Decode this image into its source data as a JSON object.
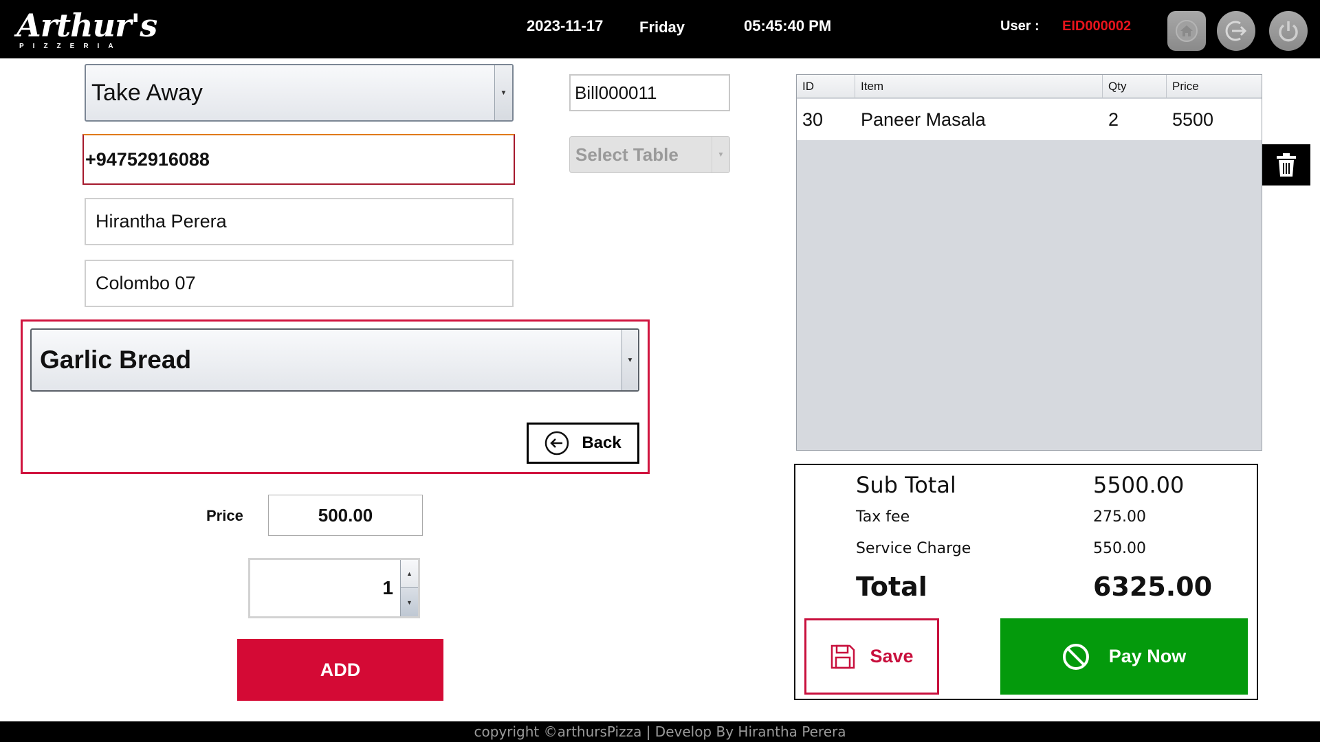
{
  "header": {
    "logo_main": "Arthur's",
    "logo_sub": "PIZZERIA",
    "date": "2023-11-17",
    "day": "Friday",
    "time": "05:45:40 PM",
    "user_label": "User :",
    "user_id": "EID000002",
    "icons": [
      "home-icon",
      "logout-icon",
      "power-icon"
    ]
  },
  "order_form": {
    "order_type": "Take Away",
    "phone": "+94752916088",
    "customer_name": "Hirantha Perera",
    "address": "Colombo 07",
    "bill_no": "Bill000011",
    "table_select": "Select Table"
  },
  "item_panel": {
    "selected_item": "Garlic Bread",
    "back_label": "Back"
  },
  "item_entry": {
    "price_label": "Price",
    "price": "500.00",
    "quantity": "1",
    "add_label": "ADD"
  },
  "order_grid": {
    "columns": [
      "ID",
      "Item",
      "Qty",
      "Price"
    ],
    "rows": [
      {
        "id": "30",
        "item": "Paneer Masala",
        "qty": "2",
        "price": "5500"
      }
    ]
  },
  "totals": {
    "subtotal_label": "Sub Total",
    "subtotal": "5500.00",
    "tax_label": "Tax fee",
    "tax": "275.00",
    "service_label": "Service Charge",
    "service": "550.00",
    "total_label": "Total",
    "total": "6325.00",
    "save_label": "Save",
    "pay_label": "Pay Now"
  },
  "footer": {
    "text": "copyright ©arthursPizza | Develop By Hirantha Perera"
  },
  "colors": {
    "header_bg": "#000000",
    "accent_red": "#d40a35",
    "user_id_red": "#e8141c",
    "pay_green": "#049a0c",
    "grid_bg": "#d6d9de"
  }
}
